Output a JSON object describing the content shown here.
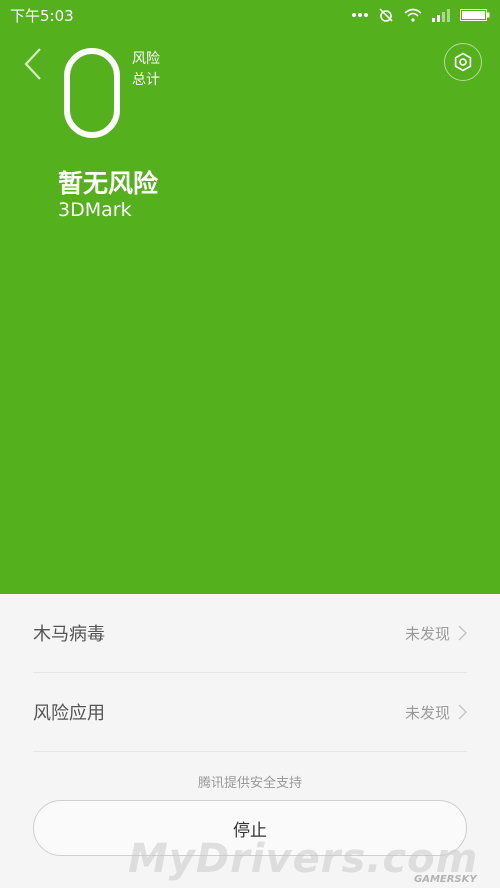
{
  "status_bar": {
    "time": "下午5:03",
    "icons": [
      "more-dots-icon",
      "alarm-icon",
      "wifi-icon",
      "signal-icon",
      "battery-icon"
    ]
  },
  "hero": {
    "background_color": "#55b01d",
    "risk_count": "0",
    "risk_label_line1": "风险",
    "risk_label_line2": "总计",
    "headline": "暂无风险",
    "app_name": "3DMark"
  },
  "results": [
    {
      "label": "木马病毒",
      "status": "未发现"
    },
    {
      "label": "风险应用",
      "status": "未发现"
    }
  ],
  "footer": {
    "provider": "腾讯提供安全支持",
    "stop_button": "停止"
  },
  "watermark": {
    "main": "MyDrivers.com",
    "sub": "GAMERSKY"
  }
}
